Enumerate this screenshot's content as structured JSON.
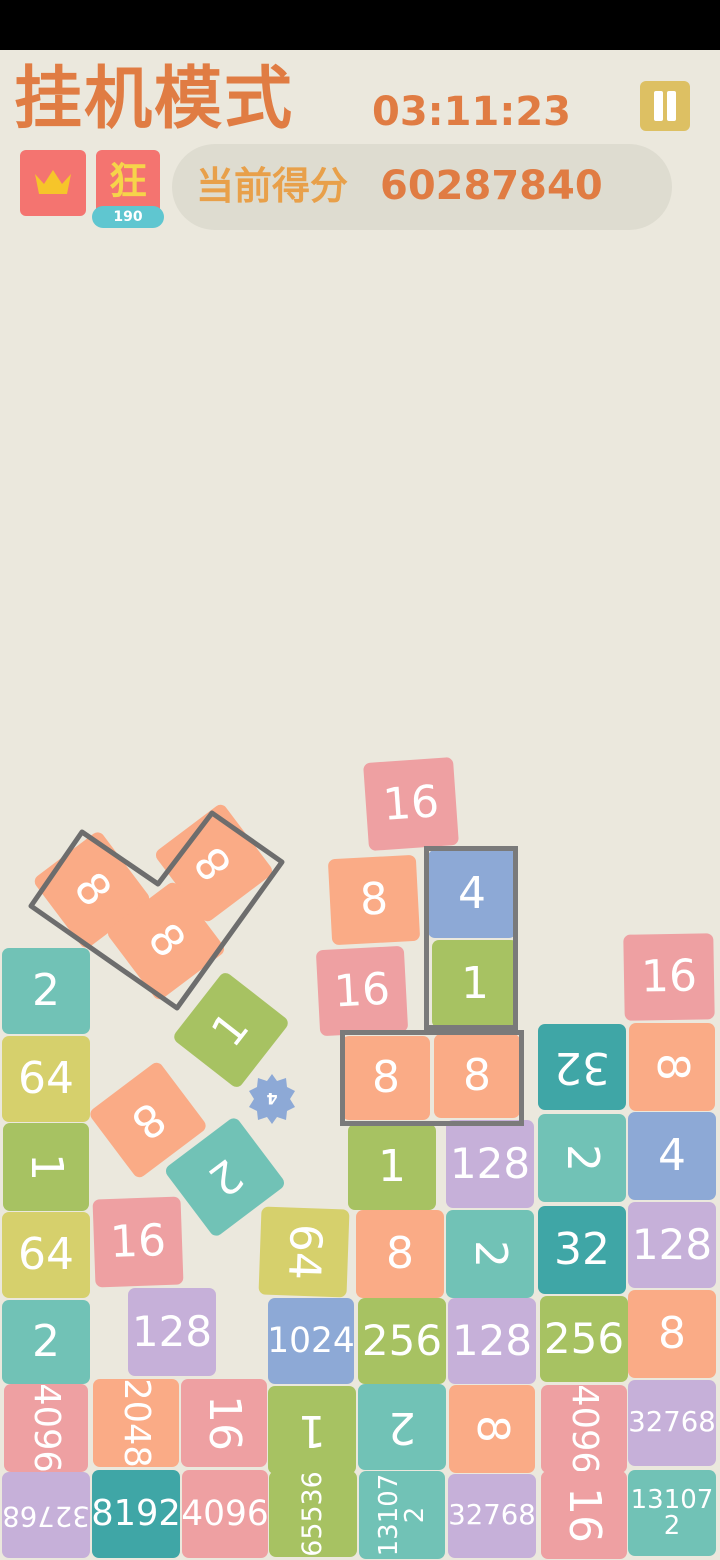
{
  "header": {
    "title": "挂机模式",
    "timer": "03:11:23",
    "mode_badge": "狂",
    "mode_count": "190",
    "score_label": "当前得分",
    "score_value": "60287840"
  },
  "colors": {
    "background": "#ebe8dd",
    "accent_orange": "#e07c43",
    "tile_1": "#a7c262",
    "tile_2": "#71c2b6",
    "tile_4": "#8da9d6",
    "tile_8": "#faab86",
    "tile_16": "#eea0a2",
    "tile_32": "#3fa6a6",
    "tile_64": "#d6d06c",
    "tile_128": "#c6b0d9",
    "tile_256": "#a7c262",
    "tile_1024": "#8da9d6",
    "tile_2048": "#faab86",
    "tile_4096": "#eea0a2",
    "tile_8192": "#3fa6a6",
    "tile_32768": "#c6b0d9",
    "tile_65536": "#a7c262",
    "tile_131072": "#71c2b6"
  },
  "icons": {
    "pause": "pause-icon",
    "crown": "crown-icon",
    "gear": "gear-icon"
  },
  "board": {
    "floating_tiles": [
      "16",
      "8",
      "4",
      "16",
      "1",
      "8",
      "8",
      "8",
      "8",
      "8",
      "1",
      "8",
      "2"
    ],
    "col1": [
      "2",
      "64",
      "1",
      "64",
      "2",
      "4096",
      "32768"
    ],
    "col2": [
      "16",
      "128",
      "2048",
      "8192"
    ],
    "col3": [
      "16",
      "4096"
    ],
    "col4": [
      "64",
      "1024",
      "1",
      "65536"
    ],
    "col5": [
      "1",
      "8",
      "256",
      "2",
      "131072"
    ],
    "col6": [
      "128",
      "2",
      "128",
      "8",
      "32768"
    ],
    "col7": [
      "32",
      "2",
      "32",
      "256",
      "4096",
      "16"
    ],
    "col8": [
      "16",
      "8",
      "4",
      "128",
      "8",
      "32768",
      "131072"
    ]
  }
}
